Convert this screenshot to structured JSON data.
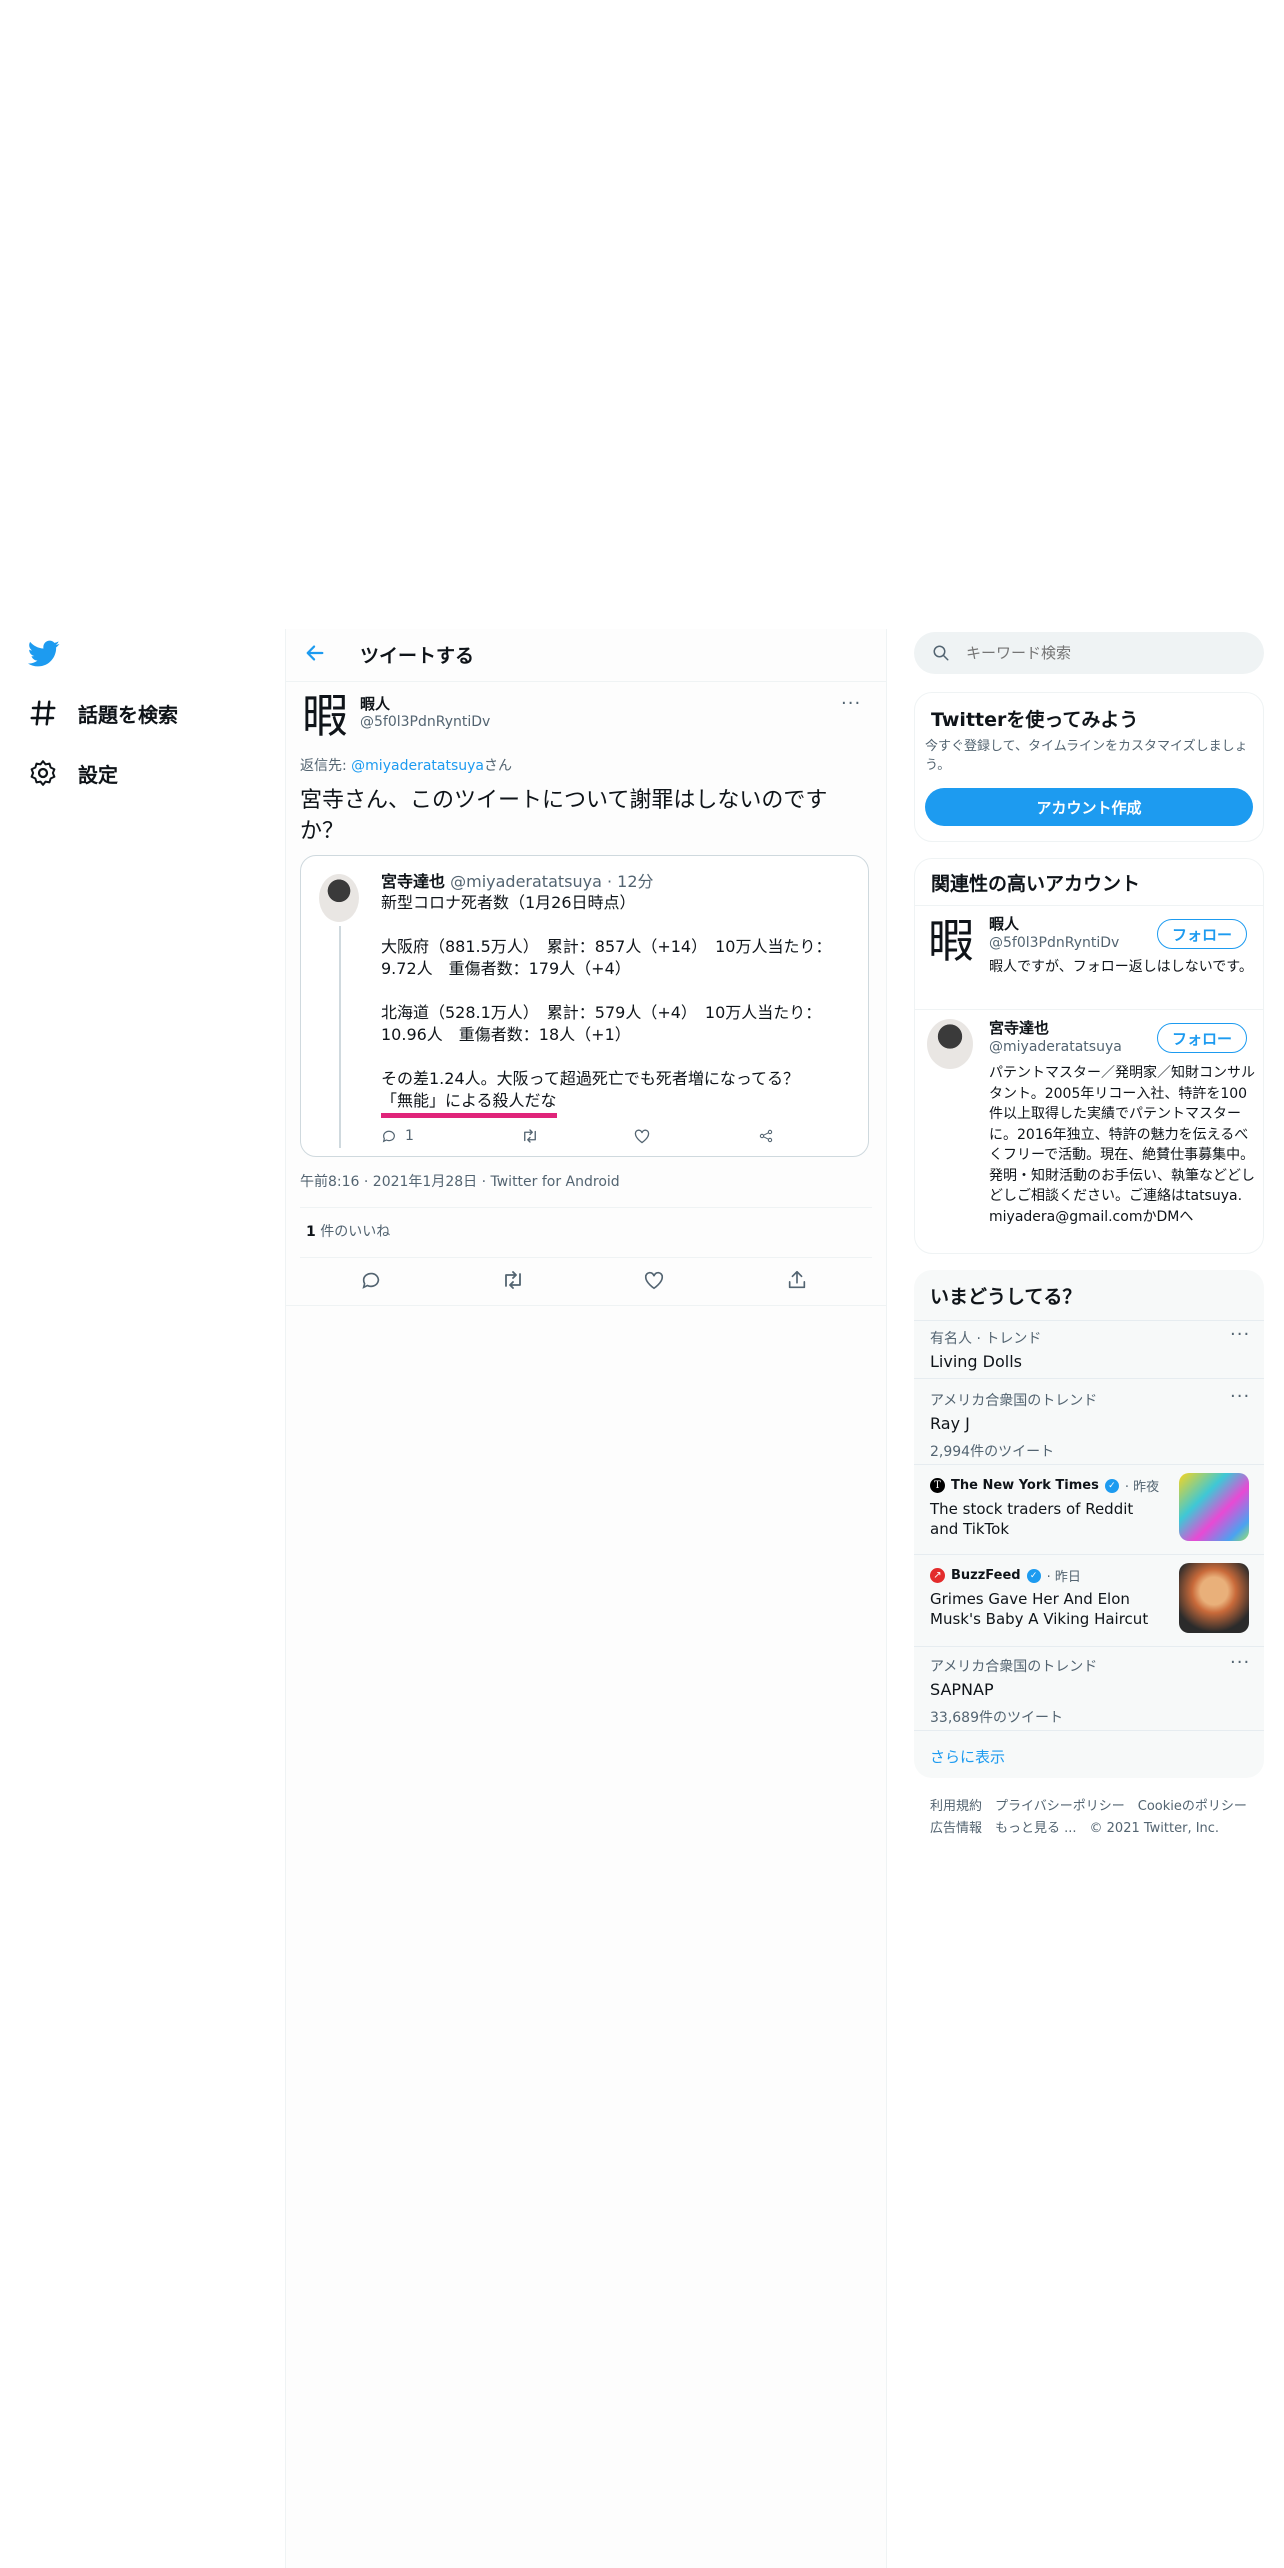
{
  "nav": {
    "items": [
      {
        "icon": "hashtag-icon",
        "label": "話題を検索"
      },
      {
        "icon": "gear-icon",
        "label": "設定"
      }
    ]
  },
  "header": {
    "title": "ツイートする"
  },
  "tweet": {
    "avatar_char": "暇",
    "name": "暇人",
    "handle": "@5f0l3PdnRyntiDv",
    "reply_prefix": "返信先: ",
    "reply_to": "@miyaderatatsuya",
    "reply_suffix": "さん",
    "text": "宮寺さん、このツイートについて謝罪はしないのですか？",
    "timestamp": "午前8:16 · 2021年1月28日 · Twitter for Android",
    "likes_count": "1",
    "likes_label": " 件のいいね"
  },
  "quote": {
    "name": "宮寺達也",
    "handle": "@miyaderatatsuya",
    "time": " · 12分",
    "lines": [
      "新型コロナ死者数（1月26日時点）",
      "",
      "大阪府（881.5万人）　累計：857人（+14）　10万人当たり：9.72人　重傷者数：179人（+4）",
      "",
      "北海道（528.1万人）　累計：579人（+4）　10万人当たり：10.96人　重傷者数：18人（+1）",
      "",
      "その差1.24人。大阪って超過死亡でも死者増になってる？"
    ],
    "underlined": "「無能」による殺人だな",
    "reply_count": "1"
  },
  "search": {
    "placeholder": "キーワード検索"
  },
  "signup": {
    "title": "Twitterを使ってみよう",
    "desc": "今すぐ登録して、タイムラインをカスタマイズしましょう。",
    "button": "アカウント作成"
  },
  "related": {
    "title": "関連性の高いアカウント",
    "follow_label": "フォロー",
    "accounts": [
      {
        "name": "暇人",
        "handle": "@5f0l3PdnRyntiDv",
        "bio": "暇人ですが、フォロー返しはしないです。"
      },
      {
        "name": "宮寺達也",
        "handle": "@miyaderatatsuya",
        "bio": "パテントマスター／発明家／知財コンサルタント。2005年リコー入社、特許を100件以上取得した実績でパテントマスターに。2016年独立、特許の魅力を伝えるべくフリーで活動。現在、絶賛仕事募集中。発明・知財活動のお手伝い、執筆などどしどしご相談ください。ご連絡はtatsuya.miyadera@gmail.comかDMへ"
      }
    ]
  },
  "trends": {
    "title": "いまどうしてる？",
    "items": [
      {
        "context": "有名人 · トレンド",
        "name": "Living Dolls",
        "count": ""
      },
      {
        "context": "アメリカ合衆国のトレンド",
        "name": "Ray J",
        "count": "2,994件のツイート"
      },
      {
        "source": "The New York Times",
        "time": " · 昨夜",
        "name": "The stock traders of Reddit and TikTok"
      },
      {
        "source": "BuzzFeed",
        "time": " · 昨日",
        "name": "Grimes Gave Her And Elon Musk's Baby A Viking Haircut"
      },
      {
        "context": "アメリカ合衆国のトレンド",
        "name": "SAPNAP",
        "count": "33,689件のツイート"
      }
    ],
    "show_more": "さらに表示"
  },
  "footer": {
    "line1": "利用規約　プライバシーポリシー　Cookieのポリシー",
    "line2": "広告情報　もっと見る ...　© 2021 Twitter, Inc."
  },
  "colors": {
    "accent": "#1d9bf0",
    "text": "#0f1419",
    "muted": "#536471",
    "underline": "#e0247a"
  }
}
